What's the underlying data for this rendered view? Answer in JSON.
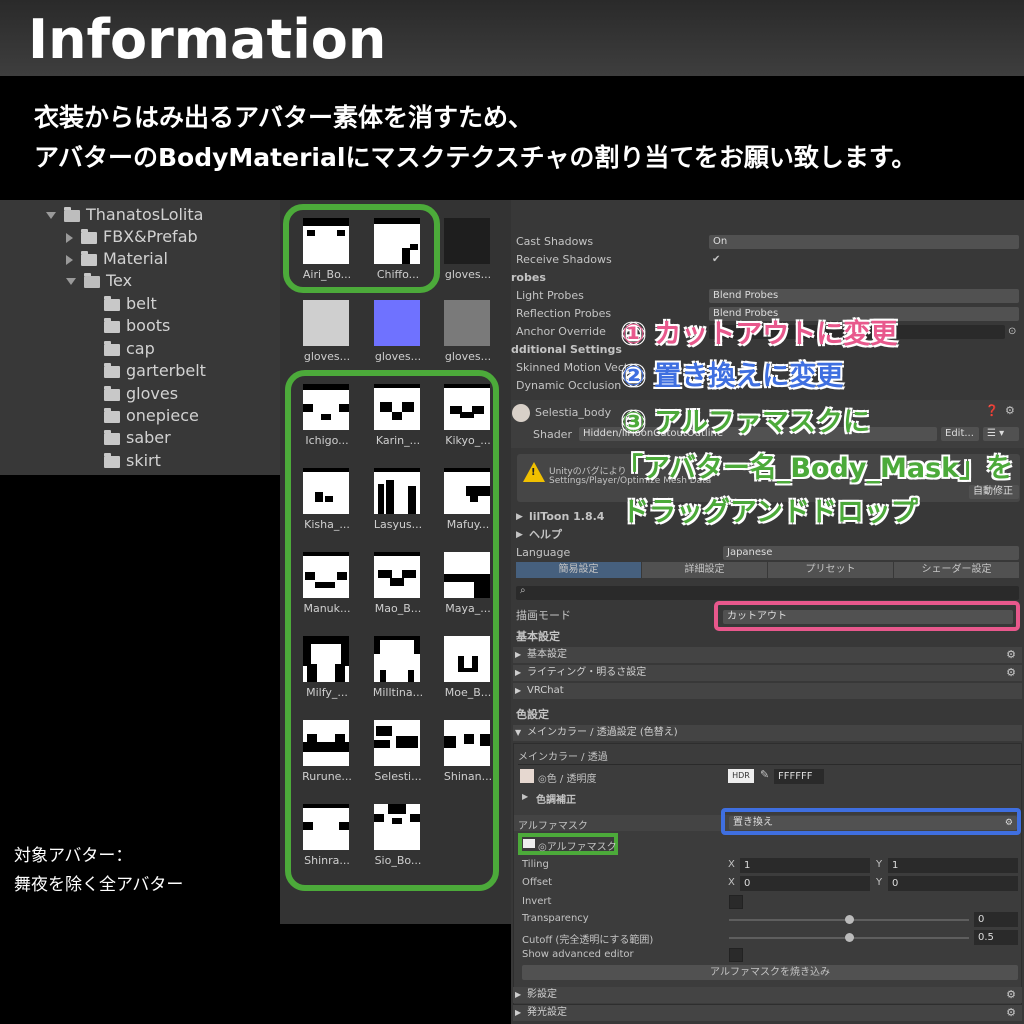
{
  "header": {
    "title": "Information"
  },
  "banner": {
    "line1": "衣装からはみ出るアバター素体を消すため、",
    "line2": "アバターのBodyMaterialにマスクテクスチャの割り当てをお願い致します。"
  },
  "project_tree": {
    "root": "ThanatosLolita",
    "fbx": "FBX&Prefab",
    "material": "Material",
    "tex": "Tex",
    "children": [
      "belt",
      "boots",
      "cap",
      "garterbelt",
      "gloves",
      "onepiece",
      "saber",
      "skirt"
    ]
  },
  "assets": [
    "Airi_Bo...",
    "Chiffo...",
    "gloves...",
    "gloves...",
    "gloves...",
    "gloves...",
    "Ichigo...",
    "Karin_...",
    "Kikyo_...",
    "Kisha_...",
    "Lasyus...",
    "Mafuy...",
    "Manuk...",
    "Mao_B...",
    "Maya_...",
    "Milfy_...",
    "Milltina...",
    "Moe_B...",
    "Rurune...",
    "Selesti...",
    "Shinan...",
    "Shinra...",
    "Sio_Bo..."
  ],
  "target_note": {
    "line1": "対象アバター：",
    "line2": "舞夜を除く全アバター"
  },
  "inspector": {
    "cast_shadows_label": "Cast Shadows",
    "cast_shadows_value": "On",
    "receive_shadows_label": "Receive Shadows",
    "probes_header": "robes",
    "light_probes_label": "Light Probes",
    "light_probes_value": "Blend Probes",
    "reflection_probes_label": "Reflection Probes",
    "reflection_probes_value": "Blend Probes",
    "anchor_override_label": "Anchor Override",
    "additional_header": "dditional Settings",
    "skinned_motion_label": "Skinned Motion Vect",
    "dynamic_occlusion_label": "Dynamic Occlusion",
    "material_name": "Selestia_body",
    "shader_label": "Shader",
    "shader_value": "Hidden/lilToonCutoutOutline",
    "edit_button": "Edit...",
    "warning_line1": "Unityのバグにより",
    "warning_line2": "Settings/Player/Optimize Mesh Data",
    "auto_fix_button": "自動修正",
    "liltoon_version": "lilToon 1.8.4",
    "help_label": "ヘルプ",
    "language_label": "Language",
    "language_value": "Japanese",
    "tabs": [
      "簡易設定",
      "詳細設定",
      "プリセット",
      "シェーダー設定"
    ],
    "render_mode_label": "描画モード",
    "render_mode_value": "カットアウト",
    "basic_settings_header": "基本設定",
    "basic_settings_bar": "基本設定",
    "lighting_bar": "ライティング・明るさ設定",
    "vrchat_bar": "VRChat",
    "color_settings_header": "色設定",
    "main_color_bar": "メインカラー / 透過設定 (色替え)",
    "main_color_sub": "メインカラー / 透過",
    "color_alpha_label": "◎色 / 透明度",
    "hdr_label": "HDR",
    "color_hex": "FFFFFF",
    "color_correction_label": "色調補正",
    "alpha_mask_label": "アルファマスク",
    "alpha_mask_mode": "置き換え",
    "alpha_mask_slot": "◎アルファマスク",
    "tiling_label": "Tiling",
    "tiling_x": "1",
    "tiling_y": "1",
    "offset_label": "Offset",
    "offset_x": "0",
    "offset_y": "0",
    "x_label": "X",
    "y_label": "Y",
    "invert_label": "Invert",
    "transparency_label": "Transparency",
    "transparency_value": "0",
    "cutoff_label": "Cutoff (完全透明にする範囲)",
    "cutoff_value": "0.5",
    "show_advanced_label": "Show advanced editor",
    "bake_button": "アルファマスクを焼き込み",
    "shadow_bar": "影設定",
    "emission_bar": "発光設定"
  },
  "annotations": {
    "step1": "① カットアウトに変更",
    "step2": "② 置き換えに変更",
    "step3a": "③ アルファマスクに",
    "step3b": "「アバター名_Body_Mask」を",
    "step3c": "ドラッグアンドドロップ"
  },
  "colors": {
    "pink": "#e8588c",
    "blue": "#3f6fe0",
    "green": "#4caa3a"
  }
}
